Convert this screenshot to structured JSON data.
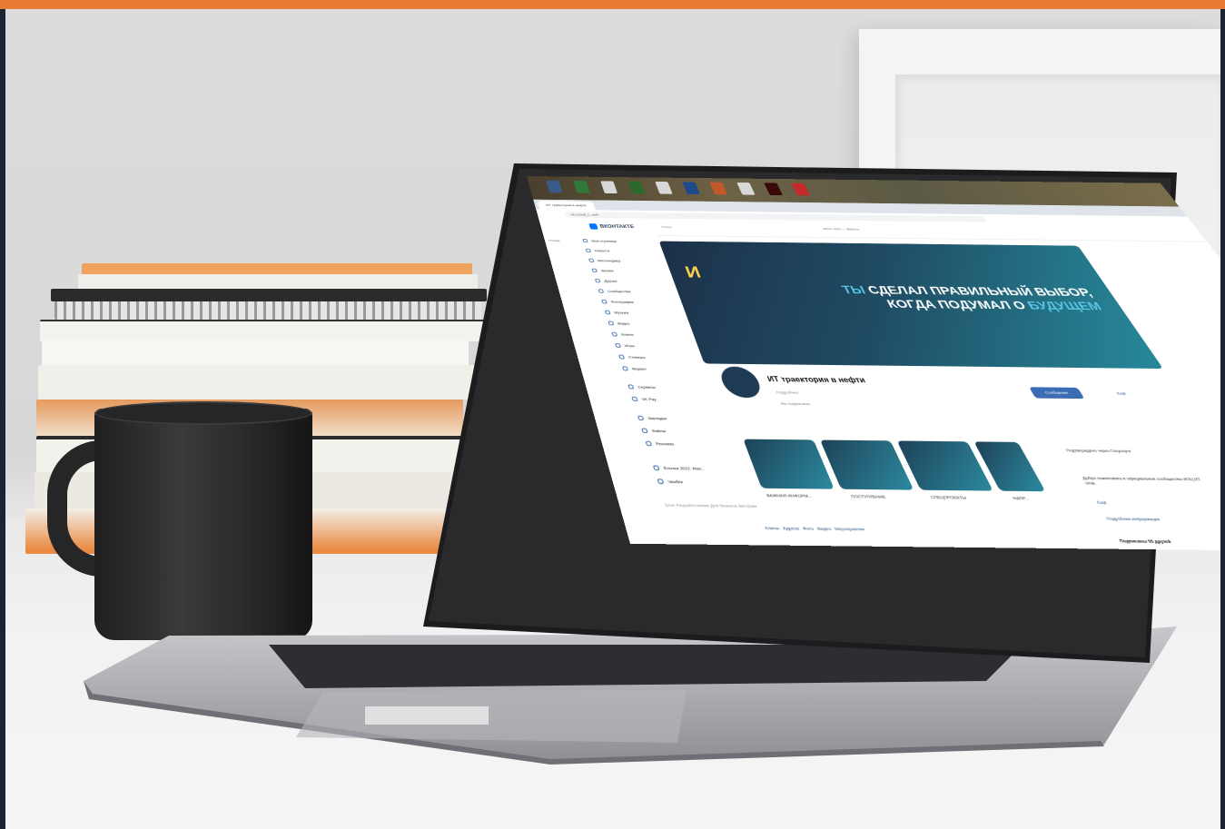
{
  "screen": {
    "taskbar_icons": [
      "app-icon",
      "app-icon",
      "app-icon",
      "app-icon",
      "app-icon",
      "app-icon",
      "app-icon",
      "app-icon",
      "illustrator-icon",
      "pdf-icon"
    ],
    "browser_tab": "ИТ траектория в нефти",
    "url": "vk.com/it_t...neft",
    "vk": {
      "logo": "ВКОНТАКТЕ",
      "search_placeholder": "Поиск",
      "now_playing": "Elton John — Believe",
      "back_label": "Назад",
      "menu": [
        "Моя страница",
        "Новости",
        "Мессенджер",
        "Звонки",
        "Друзья",
        "Сообщества",
        "Фотографии",
        "Музыка",
        "Видео",
        "Клипы",
        "Игры",
        "Стикеры",
        "Маркет",
        "Сервисы",
        "VK Pay",
        "Закладки",
        "Файлы",
        "Реклама",
        "Ёлочка 2022: Мал...",
        "Чекбек"
      ],
      "footer_links": "Блог  Разработчикам  Для бизнеса  Авторам",
      "cover_title_line1_accent": "ТЫ",
      "cover_title_line1": "СДЕЛАЛ ПРАВИЛЬНЫЙ ВЫБОР,",
      "cover_title_line2": "КОГДА ПОДУМАЛ О",
      "cover_title_line2_accent": "БУДУЩЕМ",
      "cover_logo": "И",
      "group_name": "ИТ траектория в нефти",
      "group_status": "Подробнее",
      "group_members": "Вы подписаны",
      "message_button": "Сообщение",
      "more_button": "Ещё",
      "tiles": [
        {
          "label": "ВАЖНАЯ ИНФОРМ..."
        },
        {
          "label": "ПОСТУПЛЕНИЕ"
        },
        {
          "label": "СПЕЦПРОЕКТЫ"
        },
        {
          "label": "НАПР..."
        }
      ],
      "side_info": {
        "verified": "Подтверждено через Госуслуги",
        "welcome": "Добро пожаловать в официальное сообщество ИОЦ ИТ НЧА",
        "more": "Ещё",
        "details": "Подробная информация"
      },
      "tabs": [
        "Клипы",
        "Адреса",
        "Фото",
        "Видео",
        "Мероприятия"
      ],
      "subscribers": "Подписаны 55 друзей"
    }
  },
  "colors": {
    "top_bar": "#e87a35",
    "frame": "#1e2333",
    "vk_blue": "#0077ff",
    "cover_dark": "#1c3048",
    "cover_teal": "#27899a"
  }
}
